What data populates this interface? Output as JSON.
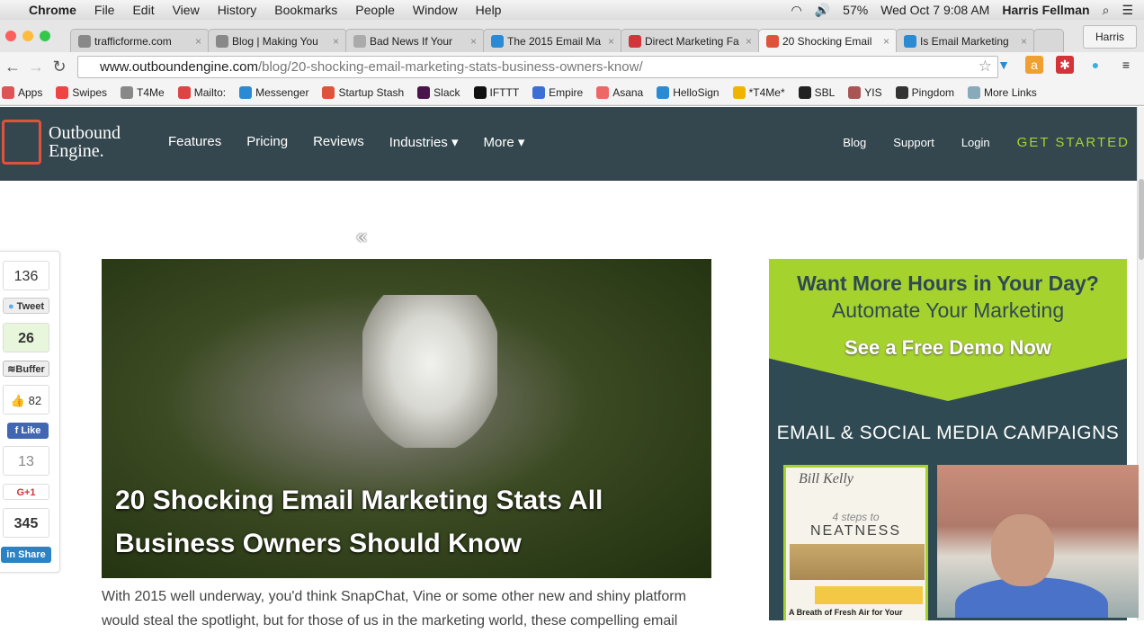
{
  "menubar": {
    "app": "Chrome",
    "items": [
      "File",
      "Edit",
      "View",
      "History",
      "Bookmarks",
      "People",
      "Window",
      "Help"
    ],
    "battery": "57%",
    "datetime": "Wed Oct 7  9:08 AM",
    "user": "Harris Fellman"
  },
  "tabs": [
    {
      "label": "trafficforme.com",
      "color": "#888"
    },
    {
      "label": "Blog | Making You",
      "color": "#888"
    },
    {
      "label": "Bad News If Your",
      "color": "#aaa"
    },
    {
      "label": "The 2015 Email Ma",
      "color": "#2a8ad4"
    },
    {
      "label": "Direct Marketing Fa",
      "color": "#d2343a"
    },
    {
      "label": "20 Shocking Email",
      "color": "#e0533b",
      "active": true
    },
    {
      "label": "Is Email Marketing",
      "color": "#2a8ad4"
    }
  ],
  "profile": "Harris",
  "address": {
    "host": "www.outboundengine.com",
    "path": "/blog/20-shocking-email-marketing-stats-business-owners-know/"
  },
  "bookmarks": [
    "Apps",
    "Swipes",
    "T4Me",
    "Mailto:",
    "Messenger",
    "Startup Stash",
    "Slack",
    "IFTTT",
    "Empire",
    "Asana",
    "HelloSign",
    "*T4Me*",
    "SBL",
    "YIS",
    "Pingdom",
    "More Links"
  ],
  "site": {
    "logo_line1": "Outbound",
    "logo_line2": "Engine.",
    "nav": [
      "Features",
      "Pricing",
      "Reviews",
      "Industries ▾",
      "More ▾"
    ],
    "right": [
      "Blog",
      "Support",
      "Login"
    ],
    "cta": "GET STARTED"
  },
  "share": {
    "twitter_count": "136",
    "tweet": "Tweet",
    "buffer_count": "26",
    "buffer": "Buffer",
    "fb_count": "82",
    "like": "Like",
    "gplus_count": "13",
    "gplus": "G+1",
    "linkedin_count": "345",
    "linkedin": "Share"
  },
  "article": {
    "title": "20 Shocking Email Marketing Stats All Business Owners Should Know",
    "intro": "With 2015 well underway, you'd think SnapChat, Vine or some other new and shiny platform would steal the spotlight, but for those of us in the marketing world, these compelling email"
  },
  "ad": {
    "headline": "Want More Hours in Your Day?",
    "sub": "Automate Your Marketing",
    "demo": "See a Free Demo Now",
    "campaigns": "EMAIL & SOCIAL MEDIA CAMPAIGNS",
    "thumb_brand": "Bill Kelly",
    "thumb_steps": "4 steps to",
    "thumb_title": "NEATNESS",
    "thumb_footer": "A Breath of Fresh Air for Your"
  },
  "colors": {
    "nav_bg": "#34474f",
    "accent_green": "#a6d22e",
    "brand_red": "#e0533b"
  }
}
